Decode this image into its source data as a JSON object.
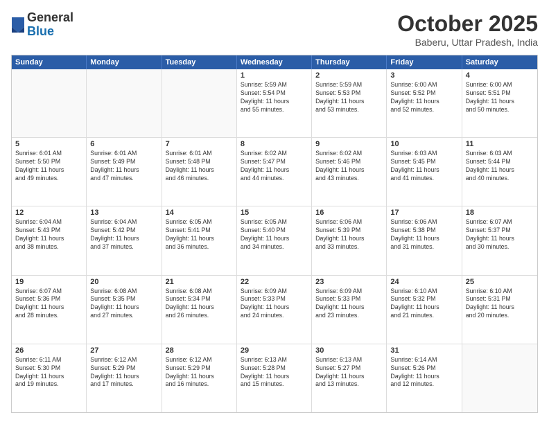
{
  "header": {
    "logo_general": "General",
    "logo_blue": "Blue",
    "month": "October 2025",
    "location": "Baberu, Uttar Pradesh, India"
  },
  "weekdays": [
    "Sunday",
    "Monday",
    "Tuesday",
    "Wednesday",
    "Thursday",
    "Friday",
    "Saturday"
  ],
  "rows": [
    [
      {
        "day": "",
        "info": ""
      },
      {
        "day": "",
        "info": ""
      },
      {
        "day": "",
        "info": ""
      },
      {
        "day": "1",
        "info": "Sunrise: 5:59 AM\nSunset: 5:54 PM\nDaylight: 11 hours\nand 55 minutes."
      },
      {
        "day": "2",
        "info": "Sunrise: 5:59 AM\nSunset: 5:53 PM\nDaylight: 11 hours\nand 53 minutes."
      },
      {
        "day": "3",
        "info": "Sunrise: 6:00 AM\nSunset: 5:52 PM\nDaylight: 11 hours\nand 52 minutes."
      },
      {
        "day": "4",
        "info": "Sunrise: 6:00 AM\nSunset: 5:51 PM\nDaylight: 11 hours\nand 50 minutes."
      }
    ],
    [
      {
        "day": "5",
        "info": "Sunrise: 6:01 AM\nSunset: 5:50 PM\nDaylight: 11 hours\nand 49 minutes."
      },
      {
        "day": "6",
        "info": "Sunrise: 6:01 AM\nSunset: 5:49 PM\nDaylight: 11 hours\nand 47 minutes."
      },
      {
        "day": "7",
        "info": "Sunrise: 6:01 AM\nSunset: 5:48 PM\nDaylight: 11 hours\nand 46 minutes."
      },
      {
        "day": "8",
        "info": "Sunrise: 6:02 AM\nSunset: 5:47 PM\nDaylight: 11 hours\nand 44 minutes."
      },
      {
        "day": "9",
        "info": "Sunrise: 6:02 AM\nSunset: 5:46 PM\nDaylight: 11 hours\nand 43 minutes."
      },
      {
        "day": "10",
        "info": "Sunrise: 6:03 AM\nSunset: 5:45 PM\nDaylight: 11 hours\nand 41 minutes."
      },
      {
        "day": "11",
        "info": "Sunrise: 6:03 AM\nSunset: 5:44 PM\nDaylight: 11 hours\nand 40 minutes."
      }
    ],
    [
      {
        "day": "12",
        "info": "Sunrise: 6:04 AM\nSunset: 5:43 PM\nDaylight: 11 hours\nand 38 minutes."
      },
      {
        "day": "13",
        "info": "Sunrise: 6:04 AM\nSunset: 5:42 PM\nDaylight: 11 hours\nand 37 minutes."
      },
      {
        "day": "14",
        "info": "Sunrise: 6:05 AM\nSunset: 5:41 PM\nDaylight: 11 hours\nand 36 minutes."
      },
      {
        "day": "15",
        "info": "Sunrise: 6:05 AM\nSunset: 5:40 PM\nDaylight: 11 hours\nand 34 minutes."
      },
      {
        "day": "16",
        "info": "Sunrise: 6:06 AM\nSunset: 5:39 PM\nDaylight: 11 hours\nand 33 minutes."
      },
      {
        "day": "17",
        "info": "Sunrise: 6:06 AM\nSunset: 5:38 PM\nDaylight: 11 hours\nand 31 minutes."
      },
      {
        "day": "18",
        "info": "Sunrise: 6:07 AM\nSunset: 5:37 PM\nDaylight: 11 hours\nand 30 minutes."
      }
    ],
    [
      {
        "day": "19",
        "info": "Sunrise: 6:07 AM\nSunset: 5:36 PM\nDaylight: 11 hours\nand 28 minutes."
      },
      {
        "day": "20",
        "info": "Sunrise: 6:08 AM\nSunset: 5:35 PM\nDaylight: 11 hours\nand 27 minutes."
      },
      {
        "day": "21",
        "info": "Sunrise: 6:08 AM\nSunset: 5:34 PM\nDaylight: 11 hours\nand 26 minutes."
      },
      {
        "day": "22",
        "info": "Sunrise: 6:09 AM\nSunset: 5:33 PM\nDaylight: 11 hours\nand 24 minutes."
      },
      {
        "day": "23",
        "info": "Sunrise: 6:09 AM\nSunset: 5:33 PM\nDaylight: 11 hours\nand 23 minutes."
      },
      {
        "day": "24",
        "info": "Sunrise: 6:10 AM\nSunset: 5:32 PM\nDaylight: 11 hours\nand 21 minutes."
      },
      {
        "day": "25",
        "info": "Sunrise: 6:10 AM\nSunset: 5:31 PM\nDaylight: 11 hours\nand 20 minutes."
      }
    ],
    [
      {
        "day": "26",
        "info": "Sunrise: 6:11 AM\nSunset: 5:30 PM\nDaylight: 11 hours\nand 19 minutes."
      },
      {
        "day": "27",
        "info": "Sunrise: 6:12 AM\nSunset: 5:29 PM\nDaylight: 11 hours\nand 17 minutes."
      },
      {
        "day": "28",
        "info": "Sunrise: 6:12 AM\nSunset: 5:29 PM\nDaylight: 11 hours\nand 16 minutes."
      },
      {
        "day": "29",
        "info": "Sunrise: 6:13 AM\nSunset: 5:28 PM\nDaylight: 11 hours\nand 15 minutes."
      },
      {
        "day": "30",
        "info": "Sunrise: 6:13 AM\nSunset: 5:27 PM\nDaylight: 11 hours\nand 13 minutes."
      },
      {
        "day": "31",
        "info": "Sunrise: 6:14 AM\nSunset: 5:26 PM\nDaylight: 11 hours\nand 12 minutes."
      },
      {
        "day": "",
        "info": ""
      }
    ]
  ]
}
